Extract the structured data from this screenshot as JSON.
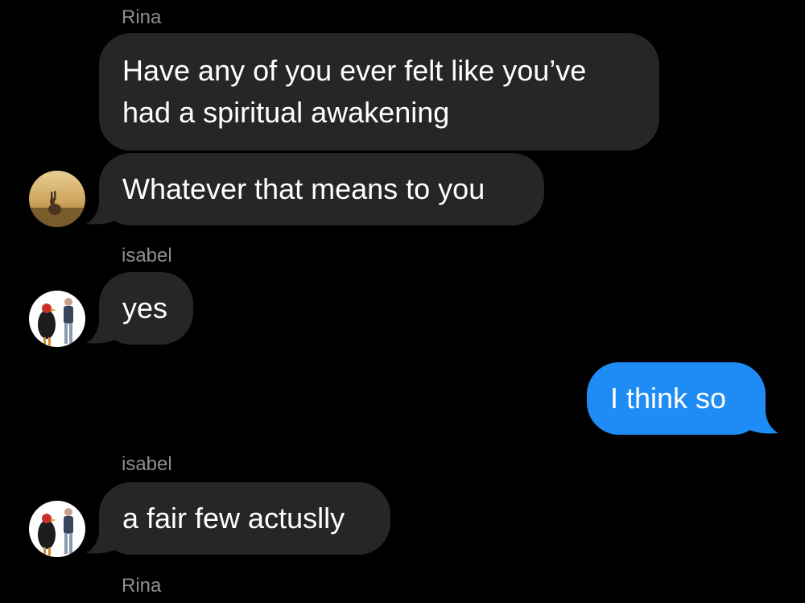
{
  "messages": [
    {
      "sender": "Rina"
    },
    {
      "text": "Have any of you ever felt like you’ve had a spiritual awakening"
    },
    {
      "text": "Whatever that means to you"
    },
    {
      "sender": "isabel"
    },
    {
      "text": "yes"
    },
    {
      "text": "I think so"
    },
    {
      "sender": "isabel"
    },
    {
      "text": "a fair few actuslly"
    },
    {
      "sender": "Rina"
    }
  ],
  "colors": {
    "background": "#000000",
    "incoming_bubble": "#262629",
    "outgoing_bubble": "#1f8bf5",
    "sender_name": "#8e8e93"
  },
  "avatars": {
    "rina": "rabbit-sunset-avatar",
    "isabel": "bird-and-man-avatar"
  }
}
